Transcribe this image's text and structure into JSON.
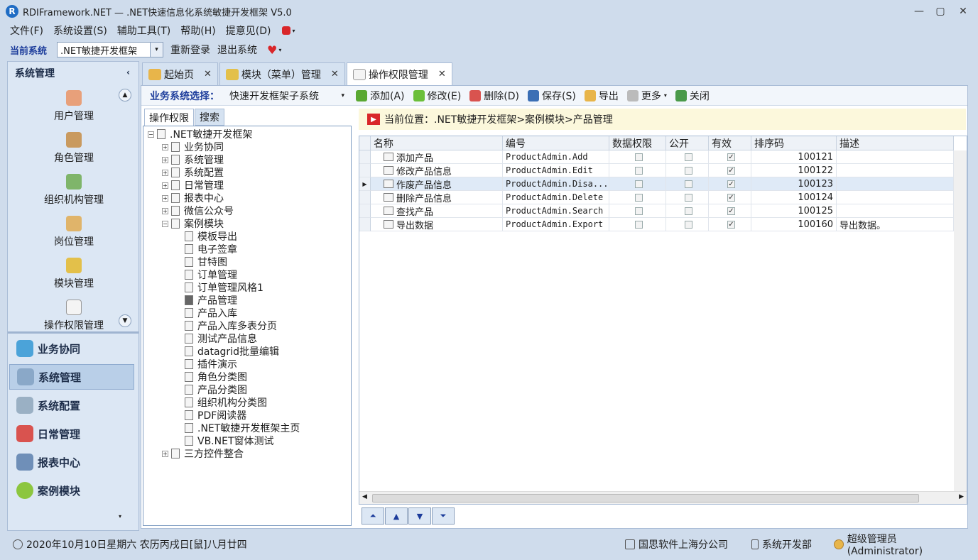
{
  "window": {
    "title": "RDIFramework.NET — .NET快速信息化系统敏捷开发框架 V5.0",
    "minimize": "—",
    "maximize": "▢",
    "close": "✕"
  },
  "menu": {
    "items": [
      "文件(F)",
      "系统设置(S)",
      "辅助工具(T)",
      "帮助(H)",
      "提意见(D)"
    ]
  },
  "system_bar": {
    "label": "当前系统",
    "selected": ".NET敏捷开发框架",
    "relogin": "重新登录",
    "logout": "退出系统"
  },
  "left_nav": {
    "title": "系统管理",
    "collapse": "‹",
    "items": [
      "用户管理",
      "角色管理",
      "组织机构管理",
      "岗位管理",
      "模块管理",
      "操作权限管理"
    ],
    "groups": [
      "业务协同",
      "系统管理",
      "系统配置",
      "日常管理",
      "报表中心",
      "案例模块"
    ]
  },
  "tabs": {
    "items": [
      {
        "label": "起始页"
      },
      {
        "label": "模块（菜单）管理"
      },
      {
        "label": "操作权限管理"
      }
    ]
  },
  "toolbar": {
    "biz_label": "业务系统选择：",
    "biz_selected": "快速开发框架子系统",
    "add": "添加(A)",
    "edit": "修改(E)",
    "delete": "删除(D)",
    "save": "保存(S)",
    "export": "导出",
    "more": "更多",
    "close": "关闭"
  },
  "subtabs": [
    "操作权限",
    "搜索"
  ],
  "tree": {
    "root": ".NET敏捷开发框架",
    "top": [
      "业务协同",
      "系统管理",
      "系统配置",
      "日常管理",
      "报表中心",
      "微信公众号",
      "案例模块"
    ],
    "children": [
      "模板导出",
      "电子签章",
      "甘特图",
      "订单管理",
      "订单管理风格1",
      "产品管理",
      "产品入库",
      "产品入库多表分页",
      "测试产品信息",
      "datagrid批量编辑",
      "插件演示",
      "角色分类图",
      "产品分类图",
      "组织机构分类图",
      "PDF阅读器",
      ".NET敏捷开发框架主页",
      "VB.NET窗体测试"
    ],
    "last": "三方控件整合"
  },
  "breadcrumb": {
    "text": "当前位置：.NET敏捷开发框架>案例模块>产品管理"
  },
  "grid": {
    "headers": [
      "名称",
      "编号",
      "数据权限",
      "公开",
      "有效",
      "排序码",
      "描述"
    ],
    "rows": [
      {
        "name": "添加产品",
        "code": "ProductAdmin.Add",
        "data_perm": false,
        "public": false,
        "valid": true,
        "sort": "100121",
        "desc": ""
      },
      {
        "name": "修改产品信息",
        "code": "ProductAdmin.Edit",
        "data_perm": false,
        "public": false,
        "valid": true,
        "sort": "100122",
        "desc": ""
      },
      {
        "name": "作废产品信息",
        "code": "ProductAdmin.Disa...",
        "data_perm": false,
        "public": false,
        "valid": true,
        "sort": "100123",
        "desc": ""
      },
      {
        "name": "删除产品信息",
        "code": "ProductAdmin.Delete",
        "data_perm": false,
        "public": false,
        "valid": true,
        "sort": "100124",
        "desc": ""
      },
      {
        "name": "查找产品",
        "code": "ProductAdmin.Search",
        "data_perm": false,
        "public": false,
        "valid": true,
        "sort": "100125",
        "desc": ""
      },
      {
        "name": "导出数据",
        "code": "ProductAdmin.Export",
        "data_perm": false,
        "public": false,
        "valid": true,
        "sort": "100160",
        "desc": "导出数据。"
      }
    ],
    "selected_index": 2
  },
  "status": {
    "date": "2020年10月10日星期六 农历丙戌日[鼠]八月廿四",
    "company": "国思软件上海分公司",
    "dept": "系统开发部",
    "user": "超级管理员(Administrator)"
  },
  "colors": {
    "accent": "#1c3c9b",
    "panel": "#dce7f4",
    "breadcrumb_bg": "#fcf8dc",
    "danger": "#d9262a"
  }
}
